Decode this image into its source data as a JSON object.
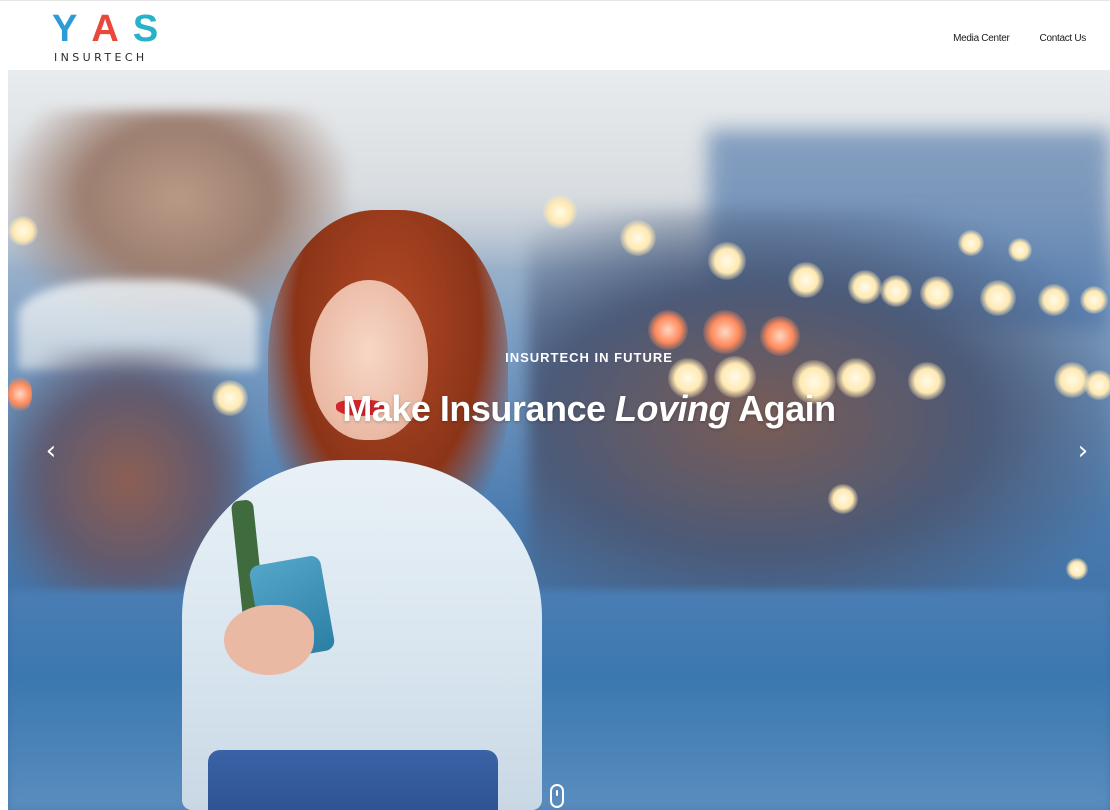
{
  "brand": {
    "letters": [
      "Y",
      "A",
      "S"
    ],
    "subtitle": "INSURTECH",
    "colors": {
      "letter_y": "#2f9bd6",
      "letter_a": "#e9483b",
      "letter_s": "#27b2c7"
    }
  },
  "nav": {
    "items": [
      {
        "label": "Media Center"
      },
      {
        "label": "Contact Us"
      }
    ]
  },
  "hero": {
    "eyebrow": "INSURTECH IN FUTURE",
    "headline_start": "Make Insurance ",
    "headline_emphasis": "Loving",
    "headline_end": " Again",
    "prev_icon": "chevron-left-icon",
    "next_icon": "chevron-right-icon",
    "prev_glyph": "‹",
    "next_glyph": "›",
    "scroll_icon": "mouse-scroll-icon"
  }
}
